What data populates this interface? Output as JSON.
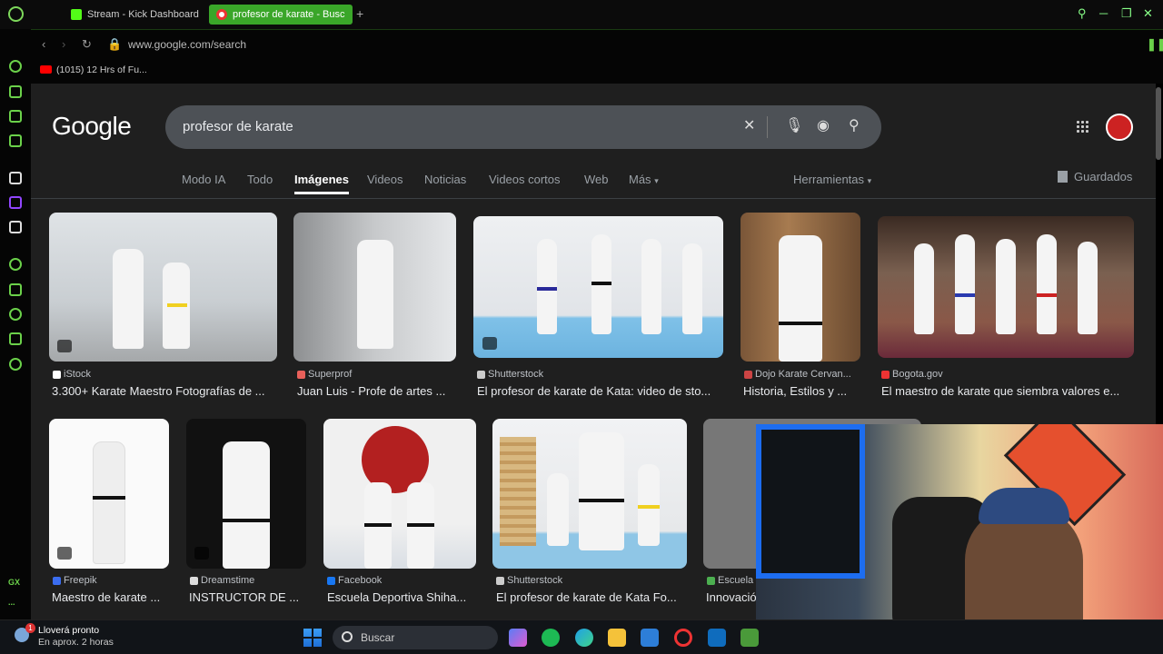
{
  "browser": {
    "tabs": [
      {
        "label": "Stream - Kick Dashboard"
      },
      {
        "label": "profesor de karate - Busc"
      }
    ],
    "new_tab": "+",
    "url": "www.google.com/search",
    "bookmark": "(1015) 12 Hrs of Fu..."
  },
  "sidebar": {
    "gx_label": "GX",
    "more_label": "..."
  },
  "google": {
    "logo": "Google",
    "query": "profesor de karate",
    "tabs": [
      "Modo IA",
      "Todo",
      "Imágenes",
      "Videos",
      "Noticias",
      "Videos cortos",
      "Web",
      "Más"
    ],
    "active_tab": "Imágenes",
    "tools": "Herramientas",
    "saved": "Guardados"
  },
  "results": [
    {
      "source": "iStock",
      "title": "3.300+ Karate Maestro Fotografías de ...",
      "fav_color": "#ffffff"
    },
    {
      "source": "Superprof",
      "title": "Juan Luis - Profe de artes ...",
      "fav_color": "#e8605a"
    },
    {
      "source": "Shutterstock",
      "title": "El profesor de karate de Kata: video de sto...",
      "fav_color": "#cccccc"
    },
    {
      "source": "Dojo Karate Cervan...",
      "title": "Historia, Estilos y ...",
      "fav_color": "#c44"
    },
    {
      "source": "Bogota.gov",
      "title": "El maestro de karate que siembra valores e...",
      "fav_color": "#e33"
    },
    {
      "source": "Freepik",
      "title": "Maestro de karate ...",
      "fav_color": "#3b6df0"
    },
    {
      "source": "Dreamstime",
      "title": "INSTRUCTOR DE ...",
      "fav_color": "#dddddd"
    },
    {
      "source": "Facebook",
      "title": "Escuela Deportiva Shiha...",
      "fav_color": "#1877f2"
    },
    {
      "source": "Shutterstock",
      "title": "El profesor de karate de Kata Fo...",
      "fav_color": "#cccccc"
    },
    {
      "source": "Escuela",
      "title": "Innovació",
      "fav_color": "#4caf50"
    }
  ],
  "taskbar": {
    "weather_title": "Lloverá pronto",
    "weather_sub": "En aprox. 2 horas",
    "weather_badge": "1",
    "search_placeholder": "Buscar"
  }
}
